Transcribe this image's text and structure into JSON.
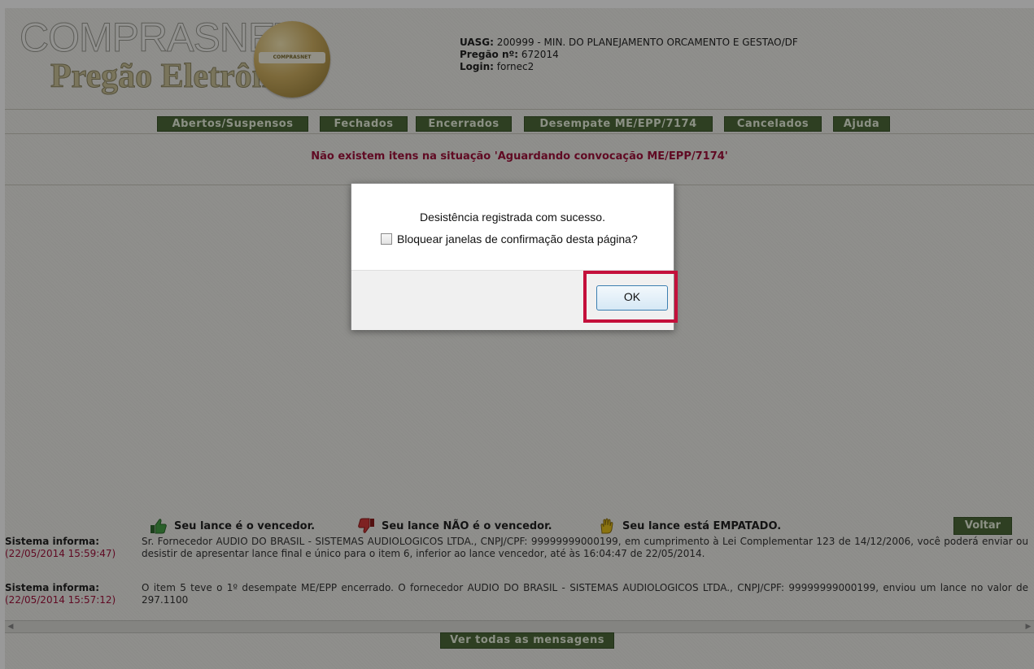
{
  "header": {
    "logo_line1": "COMPRASNET",
    "logo_line2": "Pregão Eletrônico",
    "seal_text": "COMPRASNET",
    "uasg_label": "UASG:",
    "uasg_value": "200999 - MIN. DO PLANEJAMENTO ORCAMENTO E GESTAO/DF",
    "pregao_label": "Pregão nº:",
    "pregao_value": "672014",
    "login_label": "Login:",
    "login_value": "fornec2"
  },
  "nav": {
    "items": [
      "Abertos/Suspensos",
      "Fechados",
      "Encerrados",
      "Desempate ME/EPP/7174",
      "Cancelados",
      "Ajuda"
    ]
  },
  "main": {
    "message": "Não existem itens na situação 'Aguardando convocação ME/EPP/7174'"
  },
  "legend": {
    "winner": "Seu lance é o vencedor.",
    "loser": "Seu lance NÃO é o vencedor.",
    "tied": "Seu lance está EMPATADO.",
    "back_button": "Voltar"
  },
  "messages": [
    {
      "title": "Sistema informa:",
      "timestamp": "(22/05/2014 15:59:47)",
      "text": "Sr. Fornecedor AUDIO DO BRASIL - SISTEMAS AUDIOLOGICOS LTDA., CNPJ/CPF: 99999999000199, em cumprimento à Lei Complementar 123 de 14/12/2006, você poderá enviar ou desistir de apresentar lance final e único para o item 6, inferior ao lance vencedor, até às 16:04:47 de 22/05/2014."
    },
    {
      "title": "Sistema informa:",
      "timestamp": "(22/05/2014 15:57:12)",
      "text": "O item 5 teve o 1º desempate ME/EPP encerrado. O fornecedor AUDIO DO BRASIL - SISTEMAS AUDIOLOGICOS LTDA., CNPJ/CPF: 99999999000199, enviou um lance no valor de 297.1100"
    }
  ],
  "footer": {
    "all_messages_button": "Ver todas as mensagens"
  },
  "dialog": {
    "message": "Desistência registrada com sucesso.",
    "checkbox_label": "Bloquear janelas de confirmação desta página?",
    "checkbox_checked": false,
    "ok_button": "OK",
    "highlight_color": "#c4103b"
  },
  "colors": {
    "nav_button_bg": "#4d6a3a",
    "accent_text": "#a1123b",
    "overlay": "rgba(0,0,0,0.40)"
  }
}
